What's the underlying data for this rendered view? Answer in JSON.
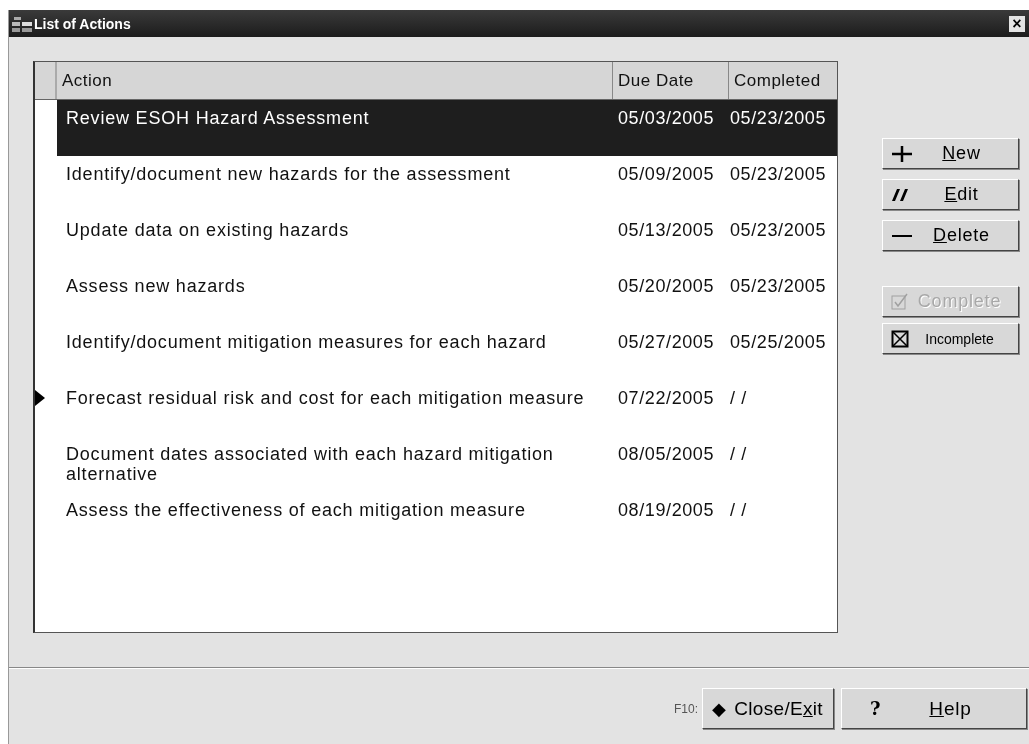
{
  "window": {
    "title": "List of Actions",
    "close": "×"
  },
  "table": {
    "columns": [
      "Action",
      "Due Date",
      "Completed"
    ],
    "rows": [
      {
        "action": "Review ESOH Hazard Assessment",
        "due": "05/03/2005",
        "completed": "05/23/2005",
        "selected": true,
        "current": false
      },
      {
        "action": "Identify/document new hazards for the assessment",
        "due": "05/09/2005",
        "completed": "05/23/2005",
        "selected": false,
        "current": false
      },
      {
        "action": "Update data on existing hazards",
        "due": "05/13/2005",
        "completed": "05/23/2005",
        "selected": false,
        "current": false
      },
      {
        "action": "Assess new hazards",
        "due": "05/20/2005",
        "completed": "05/23/2005",
        "selected": false,
        "current": false
      },
      {
        "action": "Identify/document mitigation measures for each hazard",
        "due": "05/27/2005",
        "completed": "05/25/2005",
        "selected": false,
        "current": false
      },
      {
        "action": "Forecast residual risk and cost for each mitigation measure",
        "due": "07/22/2005",
        "completed": "/ /",
        "selected": false,
        "current": true
      },
      {
        "action": "Document dates associated with each hazard mitigation alternative",
        "due": "08/05/2005",
        "completed": "/ /",
        "selected": false,
        "current": false
      },
      {
        "action": "Assess the effectiveness of each mitigation measure",
        "due": "08/19/2005",
        "completed": "/ /",
        "selected": false,
        "current": false
      }
    ]
  },
  "side_buttons": [
    {
      "kind": "new",
      "key": "N",
      "post": "ew",
      "disabled": false
    },
    {
      "kind": "edit",
      "key": "E",
      "post": "dit",
      "disabled": false
    },
    {
      "kind": "delete",
      "key": "D",
      "post": "elete",
      "disabled": false
    },
    {
      "kind": "complete",
      "pre": "Complete",
      "disabled": true
    },
    {
      "kind": "incomplete",
      "pre": "Incomplete",
      "disabled": false
    }
  ],
  "footer": {
    "shortcut": "F10:",
    "buttons": [
      {
        "kind": "close",
        "icon": "◆",
        "pre": "Close/E",
        "key": "x",
        "post": "it"
      },
      {
        "kind": "help",
        "icon": "?",
        "key": "H",
        "post": "elp"
      }
    ]
  }
}
